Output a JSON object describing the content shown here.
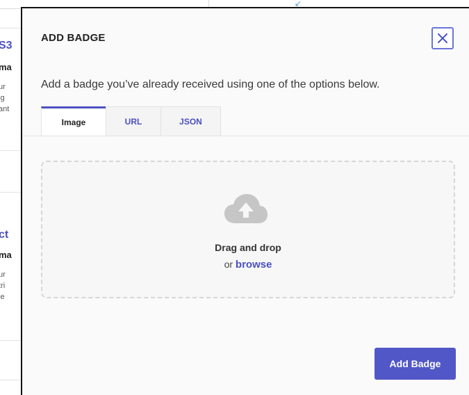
{
  "background": {
    "card1": {
      "title": "S3",
      "subtitle": "ma",
      "lines": [
        "ur",
        "ig",
        "ant"
      ]
    },
    "card2": {
      "title": "ct",
      "subtitle": "ma",
      "lines": [
        "ur",
        "tri",
        "ie"
      ]
    }
  },
  "modal": {
    "title": "ADD BADGE",
    "description": "Add a badge you’ve already received using one of the options below.",
    "close_icon": "close-icon",
    "tabs": [
      {
        "label": "Image",
        "active": true
      },
      {
        "label": "URL",
        "active": false
      },
      {
        "label": "JSON",
        "active": false
      }
    ],
    "dropzone": {
      "icon": "cloud-upload-icon",
      "main_text": "Drag and drop",
      "or_text": "or",
      "browse_text": "browse"
    },
    "submit_label": "Add Badge"
  },
  "colors": {
    "accent": "#5257c7",
    "tab_accent": "#4b50c0",
    "close_border": "#6b74d9"
  }
}
